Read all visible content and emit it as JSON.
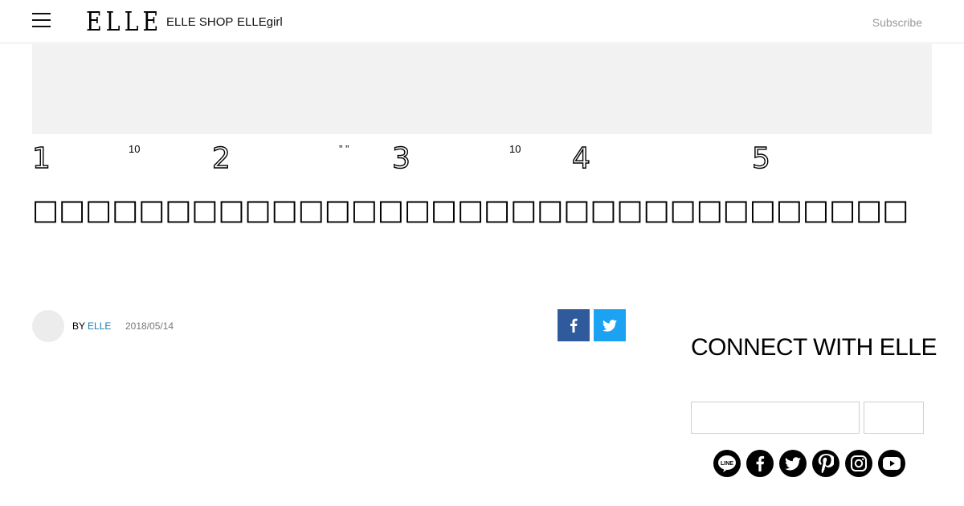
{
  "header": {
    "logo": "ELLE",
    "nav": [
      "ELLE SHOP",
      "ELLEgirl"
    ],
    "subscribe": "Subscribe"
  },
  "ranking": [
    {
      "num": "1",
      "sup": "10"
    },
    {
      "num": "2",
      "sup": "” ”"
    },
    {
      "num": "3",
      "sup": "10"
    },
    {
      "num": "4",
      "sup": ""
    },
    {
      "num": "5",
      "sup": ""
    }
  ],
  "article": {
    "headline": "□□□□□□□□□□□□□□□□□□□□□□□□□□□□□□□□□",
    "by": "BY",
    "author": "ELLE",
    "date": "2018/05/14"
  },
  "share": {
    "facebook_icon": "facebook-icon",
    "twitter_icon": "twitter-icon"
  },
  "sidebar": {
    "connect_title": "CONNECT WITH ELLE",
    "email_value": "",
    "submit_label": "",
    "social": [
      "line-icon",
      "facebook-icon",
      "twitter-icon",
      "pinterest-icon",
      "instagram-icon",
      "youtube-icon"
    ]
  }
}
